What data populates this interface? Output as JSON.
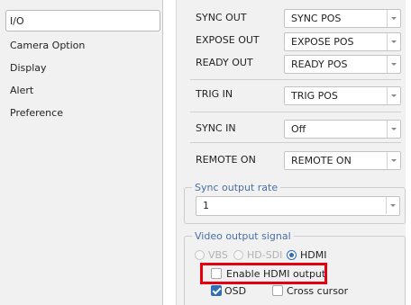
{
  "nav": {
    "items": [
      "I/O",
      "Camera Option",
      "Display",
      "Alert",
      "Preference"
    ],
    "selected": "I/O"
  },
  "io_rows": [
    {
      "label": "SYNC OUT",
      "value": "SYNC POS"
    },
    {
      "label": "EXPOSE OUT",
      "value": "EXPOSE POS"
    },
    {
      "label": "READY OUT",
      "value": "READY POS"
    },
    {
      "label": "TRIG IN",
      "value": "TRIG POS"
    },
    {
      "label": "SYNC IN",
      "value": "Off"
    },
    {
      "label": "REMOTE ON",
      "value": "REMOTE ON"
    }
  ],
  "sync_output_rate": {
    "legend": "Sync output rate",
    "value": "1"
  },
  "video_output_signal": {
    "legend": "Video output signal",
    "options": [
      {
        "label": "VBS",
        "selected": false,
        "enabled": false
      },
      {
        "label": "HD-SDI",
        "selected": false,
        "enabled": false
      },
      {
        "label": "HDMI",
        "selected": true,
        "enabled": true
      }
    ],
    "enable_hdmi_output": {
      "label": "Enable HDMI output",
      "checked": false
    },
    "osd": {
      "label": "OSD",
      "checked": true
    },
    "cross_cursor": {
      "label": "Cross cursor",
      "checked": false
    }
  },
  "colors": {
    "accent": "#2f6fb5",
    "legend_text": "#4a6fa5",
    "highlight": "#e40010",
    "panel_bg": "#f1f1f1"
  }
}
